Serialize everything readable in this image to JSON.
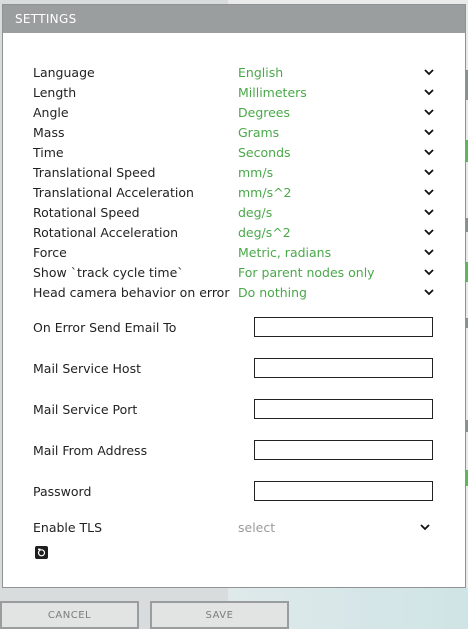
{
  "dialog": {
    "title": "SETTINGS"
  },
  "selects": [
    {
      "label": "Language",
      "value": "English"
    },
    {
      "label": "Length",
      "value": "Millimeters"
    },
    {
      "label": "Angle",
      "value": "Degrees"
    },
    {
      "label": "Mass",
      "value": "Grams"
    },
    {
      "label": "Time",
      "value": "Seconds"
    },
    {
      "label": "Translational Speed",
      "value": "mm/s"
    },
    {
      "label": "Translational Acceleration",
      "value": "mm/s^2"
    },
    {
      "label": "Rotational Speed",
      "value": "deg/s"
    },
    {
      "label": "Rotational Acceleration",
      "value": "deg/s^2"
    },
    {
      "label": "Force",
      "value": "Metric, radians"
    },
    {
      "label": "Show `track cycle time`",
      "value": "For parent nodes only"
    },
    {
      "label": "Head camera behavior on error",
      "value": "Do nothing"
    }
  ],
  "text_fields": [
    {
      "label": "On Error Send Email To",
      "value": ""
    },
    {
      "label": "Mail Service Host",
      "value": ""
    },
    {
      "label": "Mail Service Port",
      "value": ""
    },
    {
      "label": "Mail From Address",
      "value": ""
    },
    {
      "label": "Password",
      "value": ""
    }
  ],
  "tls": {
    "label": "Enable TLS",
    "placeholder": "select"
  },
  "buttons": {
    "cancel": "CANCEL",
    "save": "SAVE"
  },
  "colors": {
    "header_bg": "#9a9e9f",
    "value_green": "#4aa84a",
    "button_bg": "#e2e3e3"
  },
  "icons": {
    "chevron": "chevron-down-icon",
    "camera": "camera-icon"
  }
}
